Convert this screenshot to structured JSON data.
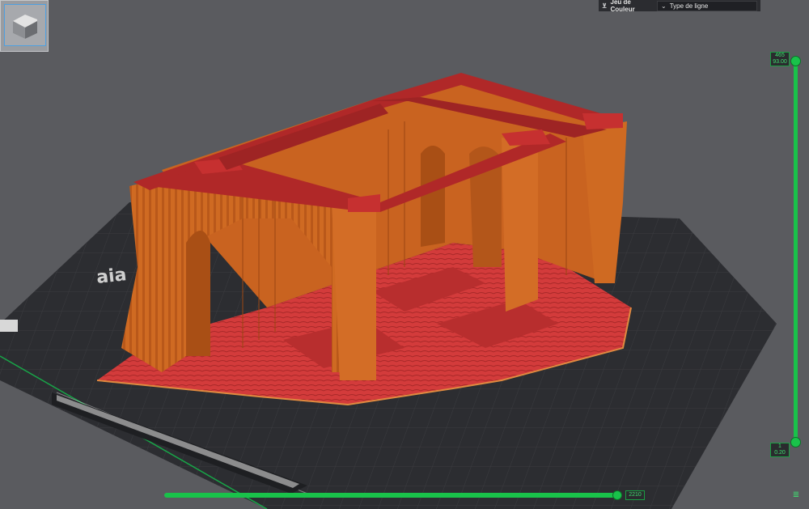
{
  "legend": {
    "color_scheme_label": "Jeu de Couleur",
    "line_type_label": "Type de ligne"
  },
  "vertical_slider": {
    "top_layer": "465",
    "top_height": "93.00",
    "bottom_layer": "1",
    "bottom_height": "0.20"
  },
  "horizontal_slider": {
    "value": "2210"
  },
  "colors": {
    "accent": "#19c24a",
    "model_wall": "#d2691e",
    "model_top": "#b22a2a",
    "floor_infill": "#d43a3a",
    "plate": "#2a2b2e",
    "background": "#5a5b5f"
  },
  "icons": {
    "collapse": "double-chevron-icon",
    "dropdown": "chevron-down-icon",
    "layers": "layers-icon"
  }
}
